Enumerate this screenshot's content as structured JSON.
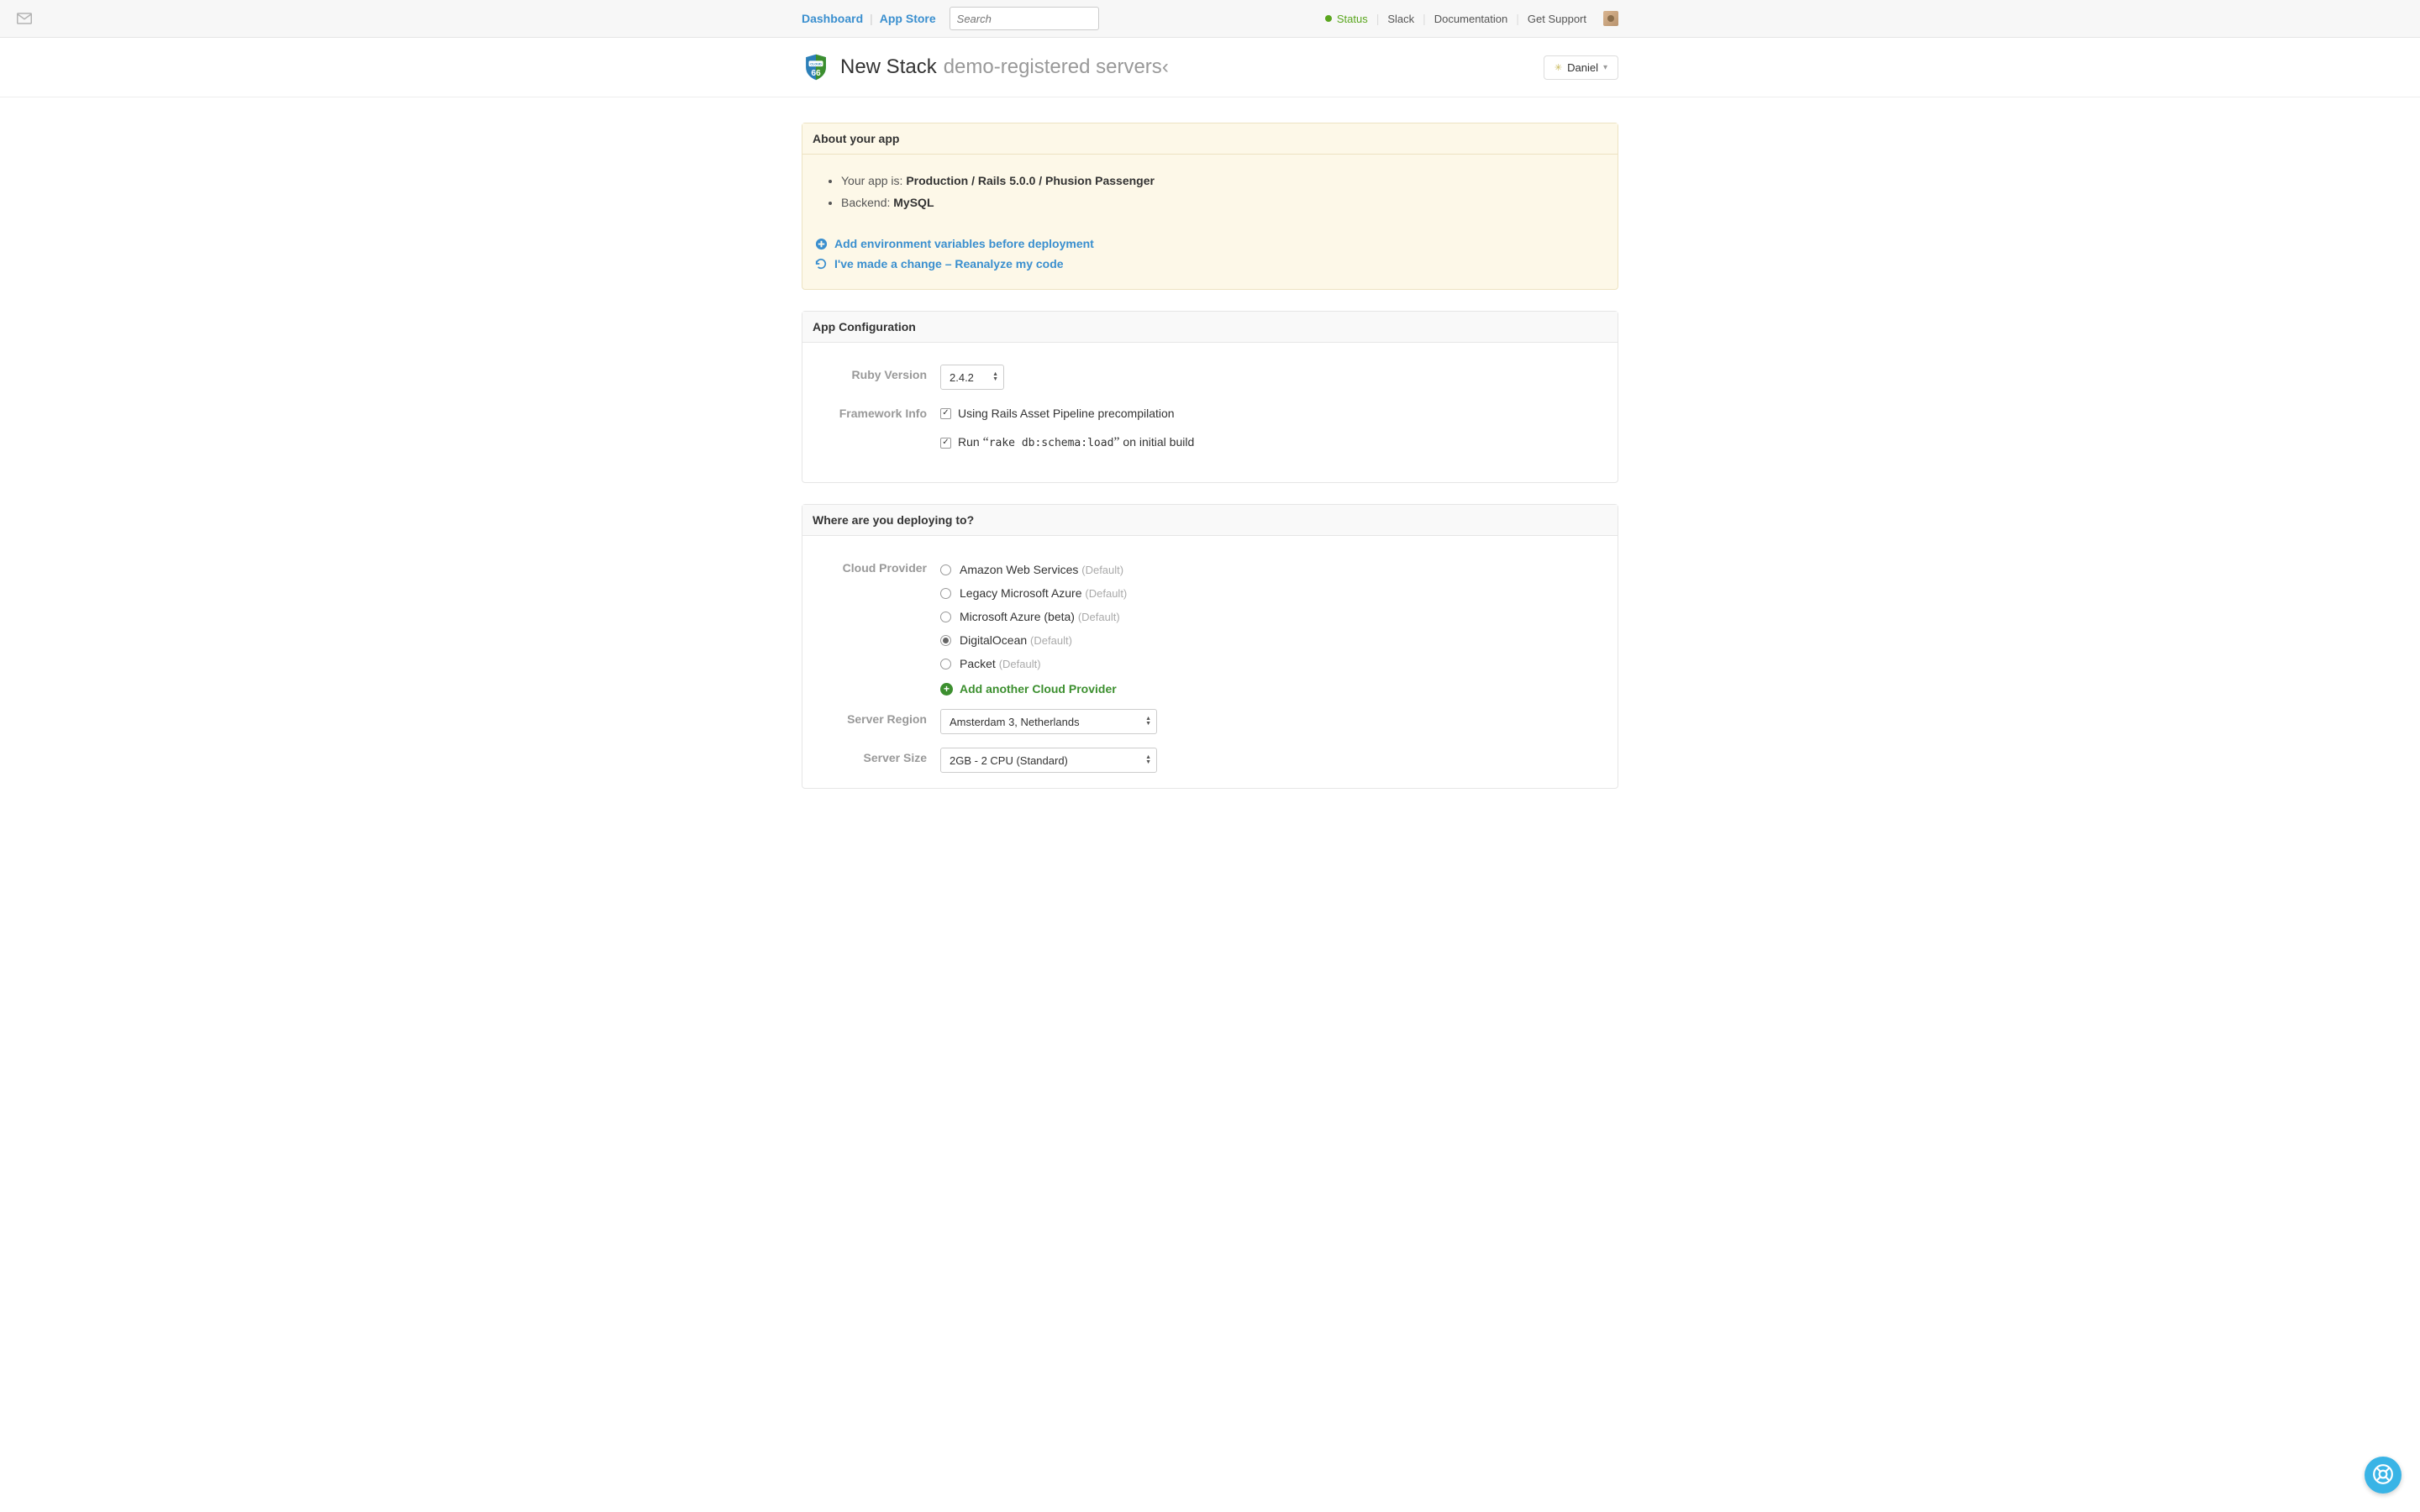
{
  "topnav": {
    "dashboard": "Dashboard",
    "appstore": "App Store",
    "search_placeholder": "Search",
    "status": "Status",
    "slack": "Slack",
    "docs": "Documentation",
    "support": "Get Support"
  },
  "header": {
    "title": "New Stack",
    "subtitle": "demo-registered servers",
    "user": "Daniel"
  },
  "about": {
    "heading": "About your app",
    "line1_prefix": "Your app is: ",
    "line1_value": "Production / Rails 5.0.0 / Phusion Passenger",
    "line2_prefix": "Backend: ",
    "line2_value": "MySQL",
    "link_env": "Add environment variables before deployment",
    "link_reanalyze": "I've made a change – Reanalyze my code"
  },
  "appconfig": {
    "heading": "App Configuration",
    "ruby_label": "Ruby Version",
    "ruby_value": "2.4.2",
    "framework_label": "Framework Info",
    "check1": "Using Rails Asset Pipeline precompilation",
    "check2_pre": "Run ",
    "check2_code": "rake db:schema:load",
    "check2_post": " on initial build"
  },
  "deploy": {
    "heading": "Where are you deploying to?",
    "provider_label": "Cloud Provider",
    "providers": [
      {
        "name": "Amazon Web Services",
        "hint": "(Default)",
        "selected": false
      },
      {
        "name": "Legacy Microsoft Azure",
        "hint": "(Default)",
        "selected": false
      },
      {
        "name": "Microsoft Azure (beta)",
        "hint": "(Default)",
        "selected": false
      },
      {
        "name": "DigitalOcean",
        "hint": "(Default)",
        "selected": true
      },
      {
        "name": "Packet",
        "hint": "(Default)",
        "selected": false
      }
    ],
    "add_provider": "Add another Cloud Provider",
    "region_label": "Server Region",
    "region_value": "Amsterdam 3, Netherlands",
    "size_label": "Server Size",
    "size_value": "2GB - 2 CPU (Standard)"
  }
}
